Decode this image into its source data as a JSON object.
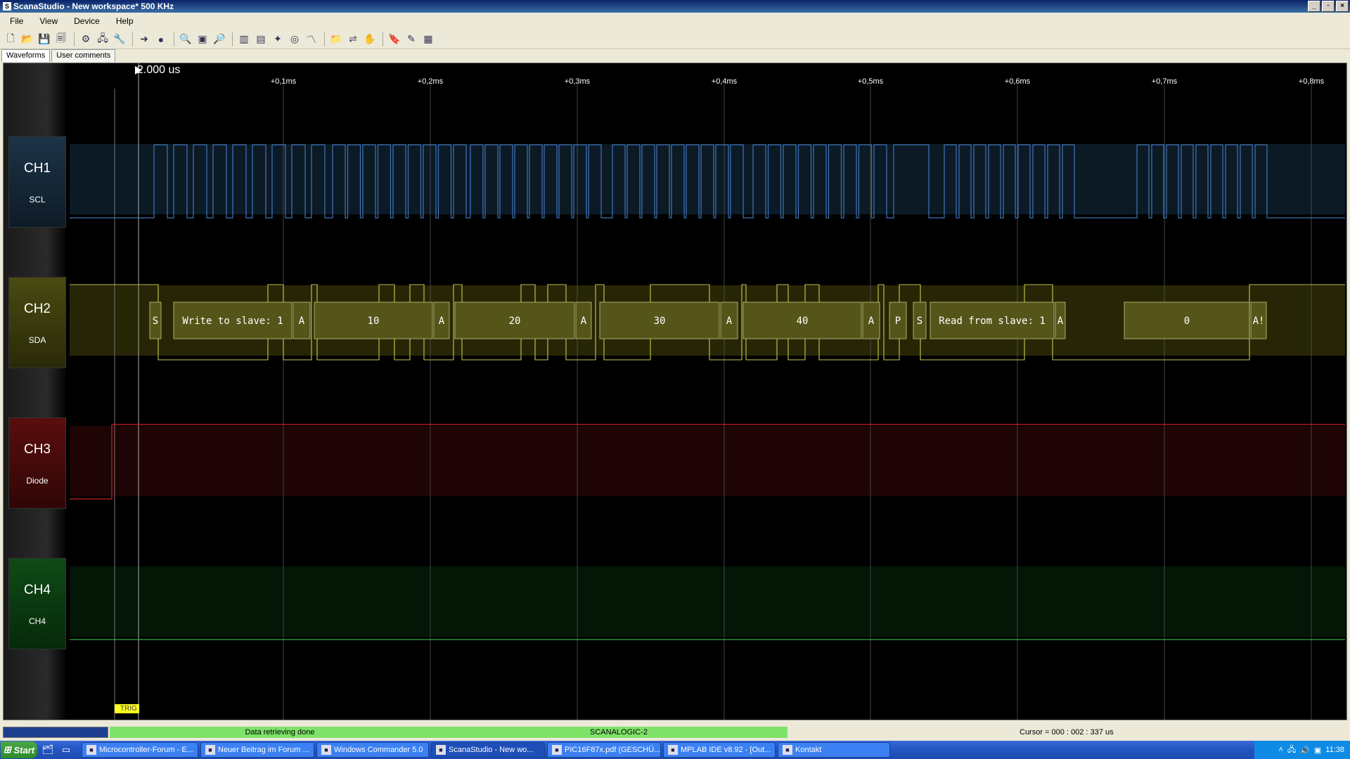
{
  "window": {
    "title": "ScanaStudio - New workspace* 500 KHz",
    "icon": "scana-icon"
  },
  "menu": [
    {
      "label": "File"
    },
    {
      "label": "View"
    },
    {
      "label": "Device"
    },
    {
      "label": "Help"
    }
  ],
  "toolbar": [
    {
      "name": "new-file-icon",
      "glyph": "🗋"
    },
    {
      "name": "open-folder-icon",
      "glyph": "📂"
    },
    {
      "name": "save-icon",
      "glyph": "💾"
    },
    {
      "name": "save-as-icon",
      "glyph": "🗐"
    },
    {
      "sep": true
    },
    {
      "name": "settings-gear-icon",
      "glyph": "⚙"
    },
    {
      "name": "device-icon",
      "glyph": "🖧"
    },
    {
      "name": "tools-icon",
      "glyph": "🔧"
    },
    {
      "sep": true
    },
    {
      "name": "start-acquisition-icon",
      "glyph": "➜"
    },
    {
      "name": "record-icon",
      "glyph": "●"
    },
    {
      "sep": true
    },
    {
      "name": "zoom-out-icon",
      "glyph": "🔍"
    },
    {
      "name": "zoom-fit-icon",
      "glyph": "▣"
    },
    {
      "name": "zoom-in-icon",
      "glyph": "🔎"
    },
    {
      "sep": true
    },
    {
      "name": "grid-vertical-icon",
      "glyph": "▥"
    },
    {
      "name": "grid-horizontal-icon",
      "glyph": "▤"
    },
    {
      "name": "decoder-icon",
      "glyph": "✦"
    },
    {
      "name": "trigger-icon",
      "glyph": "◎"
    },
    {
      "name": "analog-icon",
      "glyph": "〽"
    },
    {
      "sep": true
    },
    {
      "name": "open-workspace-icon",
      "glyph": "📁"
    },
    {
      "name": "markers-icon",
      "glyph": "⇌"
    },
    {
      "name": "hand-icon",
      "glyph": "✋"
    },
    {
      "sep": true
    },
    {
      "name": "bookmark-icon",
      "glyph": "🔖"
    },
    {
      "name": "measure-icon",
      "glyph": "✎"
    },
    {
      "name": "calculator-icon",
      "glyph": "▦"
    }
  ],
  "tabs": [
    {
      "label": "Waveforms",
      "active": true
    },
    {
      "label": "User comments",
      "active": false
    }
  ],
  "cursor_readout": "2.000 us",
  "time_ticks": [
    "+0,1ms",
    "+0,2ms",
    "+0,3ms",
    "+0,4ms",
    "+0,5ms",
    "+0,6ms",
    "+0,7ms",
    "+0,8ms"
  ],
  "channels": [
    {
      "name": "CH1",
      "signal": "SCL"
    },
    {
      "name": "CH2",
      "signal": "SDA"
    },
    {
      "name": "CH3",
      "signal": "Diode"
    },
    {
      "name": "CH4",
      "signal": "CH4"
    }
  ],
  "colors": {
    "ch1": "#3e74b8",
    "ch2": "#c8c850",
    "ch3": "#d02020",
    "ch4": "#30b040",
    "decode_text": "#ffffff"
  },
  "decode_frames": [
    {
      "text": "S"
    },
    {
      "text": "Write to slave: 1"
    },
    {
      "text": "A"
    },
    {
      "text": "10"
    },
    {
      "text": "A"
    },
    {
      "text": "20"
    },
    {
      "text": "A"
    },
    {
      "text": "30"
    },
    {
      "text": "A"
    },
    {
      "text": "40"
    },
    {
      "text": "A"
    },
    {
      "text": "P"
    },
    {
      "text": "S"
    },
    {
      "text": "Read from slave: 1"
    },
    {
      "text": "A"
    },
    {
      "text": "0"
    },
    {
      "text": "A!"
    }
  ],
  "trigger_label": "TRIG",
  "status": {
    "left": "Data retrieving done",
    "center": "SCANALOGIC-2",
    "cursor": "Cursor = 000 : 002 : 337 us"
  },
  "taskbar": {
    "start": "Start",
    "tasks": [
      {
        "label": "Microcontroller-Forum - E...",
        "icon": "ie-icon"
      },
      {
        "label": "Neuer Beitrag im Forum ...",
        "icon": "firefox-icon"
      },
      {
        "label": "Windows Commander 5.0",
        "icon": "commander-icon"
      },
      {
        "label": "ScanaStudio - New wo...",
        "icon": "scana-icon",
        "active": true
      },
      {
        "label": "PIC16F87x.pdf (GESCHÜ...",
        "icon": "pdf-icon"
      },
      {
        "label": "MPLAB IDE v8.92 - [Out...",
        "icon": "mplab-icon"
      },
      {
        "label": "Kontakt",
        "icon": "contact-icon"
      }
    ],
    "clock": "11:38"
  }
}
